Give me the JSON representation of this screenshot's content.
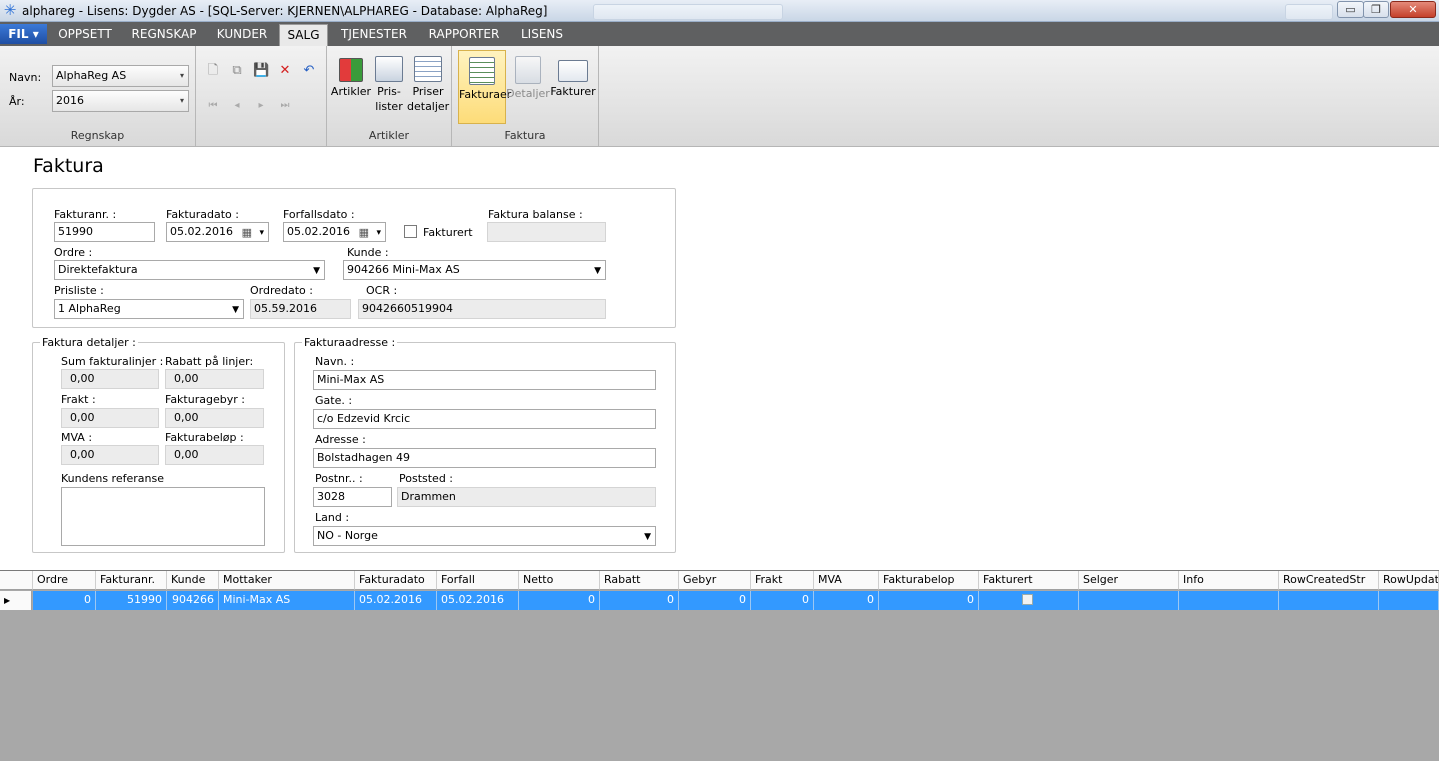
{
  "window": {
    "title": "alphareg  - Lisens: Dygder AS - [SQL-Server: KJERNEN\\ALPHAREG - Database: AlphaReg]",
    "min_glyph": "▭",
    "max_glyph": "❐",
    "close_glyph": "✕"
  },
  "menu": {
    "fil": "FIL ▾",
    "tabs": [
      "OPPSETT",
      "REGNSKAP",
      "KUNDER",
      "SALG",
      "TJENESTER",
      "RAPPORTER",
      "LISENS"
    ],
    "active": "SALG"
  },
  "ribbon": {
    "navn_label": "Navn:",
    "navn_value": "AlphaReg AS",
    "ar_label": "År:",
    "ar_value": "2016",
    "group_regnskap": "Regnskap",
    "artikler": "Artikler",
    "prislister_1": "Pris-",
    "prislister_2": "lister",
    "priser_1": "Priser",
    "priser_2": "detaljer",
    "group_artikler": "Artikler",
    "fakturaer": "Fakturaer",
    "detaljer": "Detaljer",
    "fakturer": "Fakturer",
    "group_faktura": "Faktura"
  },
  "page": {
    "title": "Faktura"
  },
  "header_form": {
    "fakturanr_label": "Fakturanr. :",
    "fakturanr": "51990",
    "fakturadato_label": "Fakturadato :",
    "fakturadato": "05.02.2016",
    "forfallsdato_label": "Forfallsdato :",
    "forfallsdato": "05.02.2016",
    "fakturert_label": "Fakturert",
    "balanse_label": "Faktura balanse :",
    "balanse": "",
    "ordre_label": "Ordre :",
    "ordre": "Direktefaktura",
    "kunde_label": "Kunde :",
    "kunde": "904266 Mini-Max AS",
    "prisliste_label": "Prisliste :",
    "prisliste": "1 AlphaReg",
    "ordredato_label": "Ordredato :",
    "ordredato": "05.59.2016",
    "ocr_label": "OCR  :",
    "ocr": "9042660519904"
  },
  "detaljer": {
    "legend": "Faktura detaljer :",
    "sum_label": "Sum fakturalinjer :",
    "sum": "0,00",
    "rabatt_label": "Rabatt på linjer:",
    "rabatt": "0,00",
    "frakt_label": "Frakt :",
    "frakt": "0,00",
    "gebyr_label": "Fakturagebyr :",
    "gebyr": "0,00",
    "mva_label": "MVA :",
    "mva": "0,00",
    "belop_label": "Fakturabeløp :",
    "belop": "0,00",
    "ref_label": "Kundens referanse",
    "ref": ""
  },
  "adresse": {
    "legend": "Fakturaadresse :",
    "navn_label": "Navn. :",
    "navn": "Mini-Max AS",
    "gate_label": "Gate. :",
    "gate": "c/o Edzevid Krcic",
    "adresse_label": "Adresse :",
    "adresse": "Bolstadhagen 49",
    "postnr_label": "Postnr.. :",
    "postnr": "3028",
    "poststed_label": "Poststed :",
    "poststed": "Drammen",
    "land_label": "Land :",
    "land": "NO - Norge"
  },
  "grid": {
    "columns": [
      "Ordre",
      "Fakturanr.",
      "Kunde",
      "Mottaker",
      "Fakturadato",
      "Forfall",
      "Netto",
      "Rabatt",
      "Gebyr",
      "Frakt",
      "MVA",
      "Fakturabelop",
      "Fakturert",
      "Selger",
      "Info",
      "RowCreatedStr",
      "RowUpdate"
    ],
    "row": {
      "ordre": "0",
      "fakturanr": "51990",
      "kunde": "904266",
      "mottaker": "Mini-Max AS",
      "fakturadato": "05.02.2016",
      "forfall": "05.02.2016",
      "netto": "0",
      "rabatt": "0",
      "gebyr": "0",
      "frakt": "0",
      "mva": "0",
      "fakturabelop": "0",
      "selger": "",
      "info": "",
      "created": "",
      "updated": ""
    }
  }
}
